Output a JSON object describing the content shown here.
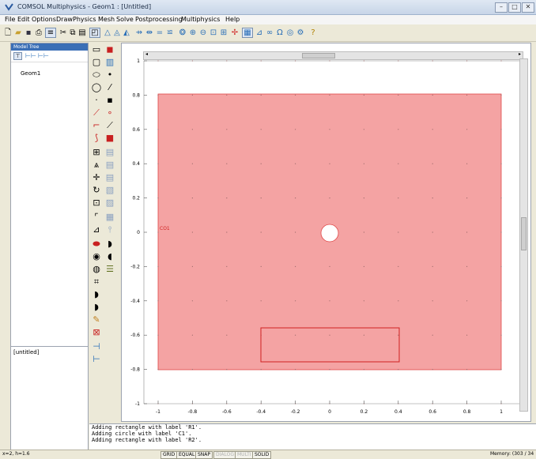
{
  "window": {
    "title": "COMSOL Multiphysics - Geom1 : [Untitled]",
    "controls": [
      "–",
      "□",
      "✕"
    ]
  },
  "menu": [
    "File",
    "Edit",
    "Options",
    "Draw",
    "Physics",
    "Mesh",
    "Solve",
    "Postprocessing",
    "Multiphysics",
    "Help"
  ],
  "model_tree": {
    "header": "Model Tree",
    "item": "Geom1"
  },
  "properties": {
    "label": "[untitled]"
  },
  "plot": {
    "x_ticks": [
      "-1",
      "-0.8",
      "-0.6",
      "-0.4",
      "-0.2",
      "0",
      "0.2",
      "0.4",
      "0.6",
      "0.8",
      "1"
    ],
    "y_ticks": [
      "1",
      "0.8",
      "0.6",
      "0.4",
      "0.2",
      "0",
      "-0.2",
      "-0.4",
      "-0.6",
      "-0.8",
      "-1"
    ],
    "object_label": "CO1",
    "fill_color": "#f4a3a3",
    "edge_color": "#e04848"
  },
  "log": [
    "Adding rectangle with label 'R1'.",
    "Adding circle with label 'C1'.",
    "Adding rectangle with label 'R2'."
  ],
  "status": {
    "coords": "x=2, h=1.6",
    "toggles": [
      {
        "label": "GRID",
        "enabled": true
      },
      {
        "label": "EQUAL",
        "enabled": true
      },
      {
        "label": "SNAP",
        "enabled": true
      },
      {
        "label": "DIALOG",
        "enabled": false
      },
      {
        "label": "MULTI",
        "enabled": false
      },
      {
        "label": "SOLID",
        "enabled": true
      }
    ],
    "memory": "Memory: (303 / 34"
  }
}
